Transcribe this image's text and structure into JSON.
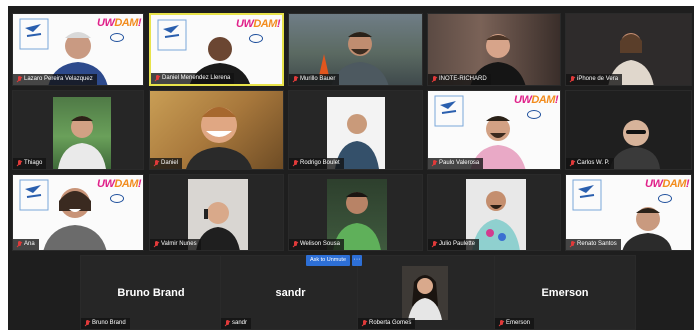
{
  "brand_logo": {
    "text_a": "UW",
    "text_b": "DAM",
    "text_c": "!"
  },
  "participants": [
    {
      "name": "Lazaro Pereira Velazquez"
    },
    {
      "name": "Daniel Menendez Llerena"
    },
    {
      "name": "Murillo Bauer"
    },
    {
      "name": "INOTE-RICHARD"
    },
    {
      "name": "iPhone de Vera"
    },
    {
      "name": "Thiago"
    },
    {
      "name": "Daniel"
    },
    {
      "name": "Rodrigo Boulet"
    },
    {
      "name": "Paulo Valerosa"
    },
    {
      "name": "Carlos W. P."
    },
    {
      "name": "Ana"
    },
    {
      "name": "Valmir Nunes"
    },
    {
      "name": "Welison Sousa"
    },
    {
      "name": "Julio Paulette"
    },
    {
      "name": "Renato Santos"
    },
    {
      "name": "Bruno Brand",
      "display": "Bruno Brand"
    },
    {
      "name": "sandr",
      "display": "sandr"
    },
    {
      "name": "Roberta Gomes"
    },
    {
      "name": "Emerson",
      "display": "Emerson"
    }
  ],
  "controls": {
    "ask_unmute": "Ask to Unmute",
    "more": "···"
  },
  "colors": {
    "active_speaker": "#e8e34a",
    "muted_icon": "#e03a3a",
    "button": "#2d6fd6"
  }
}
